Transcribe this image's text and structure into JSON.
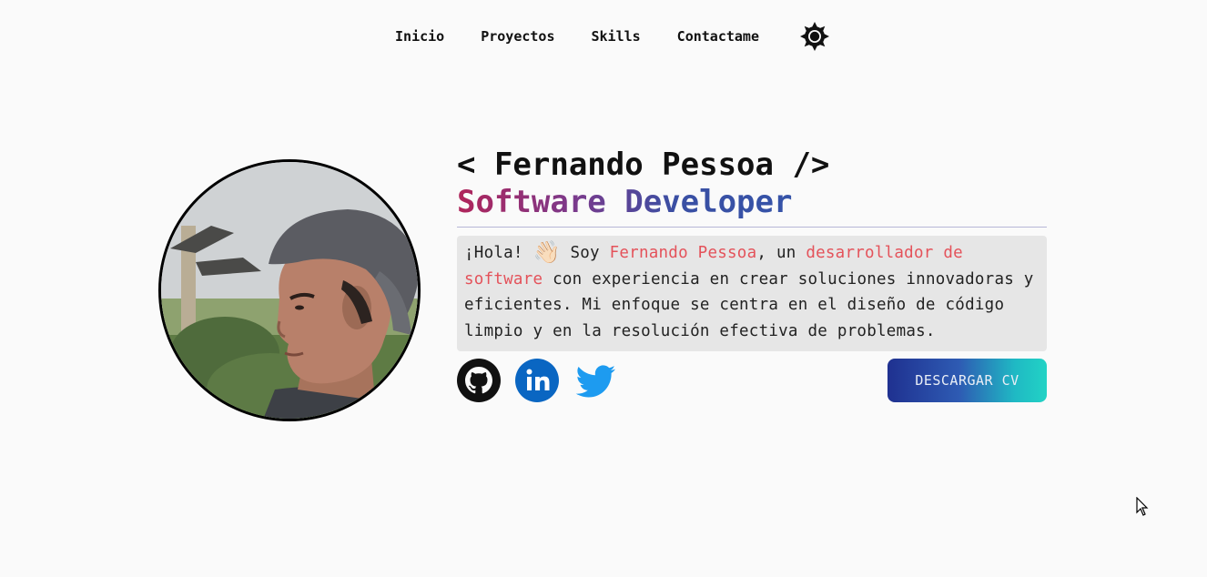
{
  "nav": {
    "items": [
      {
        "label": "Inicio"
      },
      {
        "label": "Proyectos"
      },
      {
        "label": "Skills"
      },
      {
        "label": "Contactame"
      }
    ],
    "theme_icon": "sun-icon"
  },
  "profile": {
    "avatar_icon": "profile-photo",
    "name_line": "< Fernando Pessoa />",
    "role": "Software Developer",
    "bio": {
      "greeting": "¡Hola!",
      "wave": "👋🏻",
      "intro": " Soy ",
      "name": "Fernando Pessoa",
      "mid": ", un ",
      "role_phrase": "desarrollador de software",
      "rest": " con experiencia en crear soluciones innovadoras y eficientes. Mi enfoque se centra en el diseño de código limpio y en la resolución efectiva de problemas."
    }
  },
  "socials": [
    {
      "name": "github-icon",
      "color": "#111111"
    },
    {
      "name": "linkedin-icon",
      "color": "#0a66c2"
    },
    {
      "name": "twitter-icon",
      "color": "#1d9bf0"
    }
  ],
  "cta": {
    "label": "DESCARGAR CV"
  },
  "colors": {
    "background": "#fafafa",
    "role_gradient": [
      "#b0245a",
      "#3553a8"
    ],
    "highlight": "#e4525a",
    "button_gradient": [
      "#1f3190",
      "#22d3c5"
    ]
  }
}
